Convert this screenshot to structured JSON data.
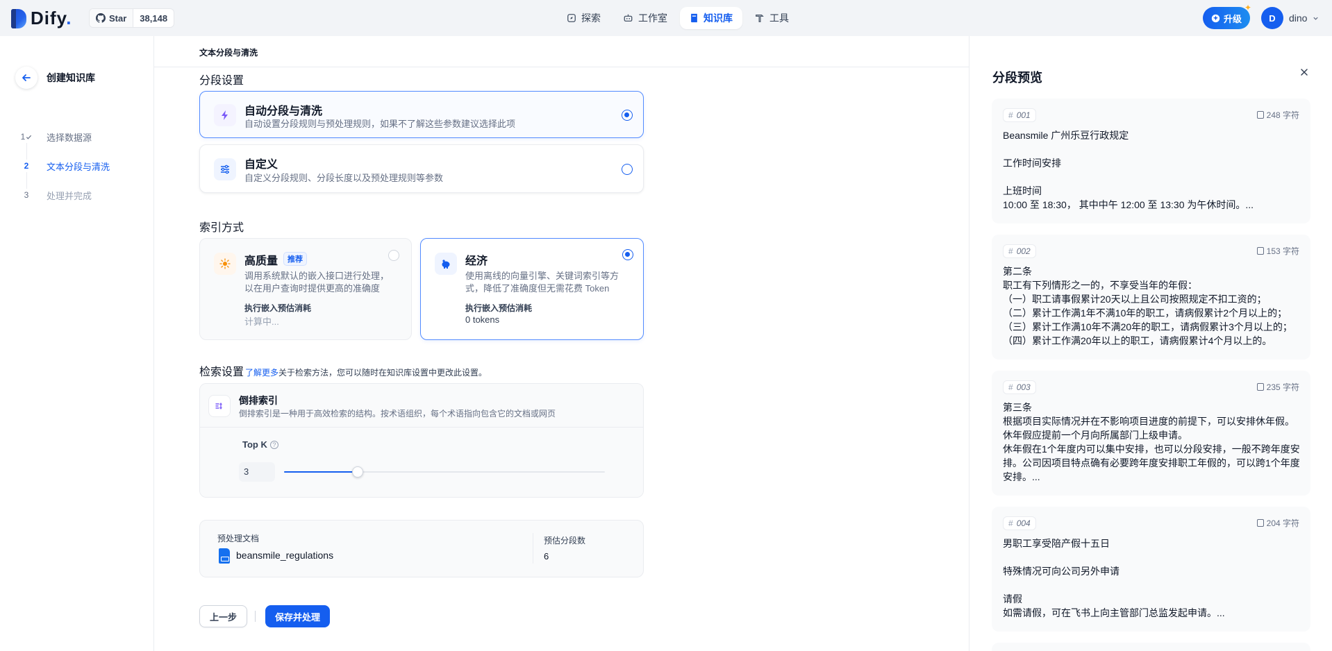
{
  "header": {
    "logo": {
      "text": "Dify",
      "dot": "."
    },
    "github": {
      "star_label": "Star",
      "count": "38,148"
    },
    "nav": [
      {
        "label": "探索",
        "icon": "explore-icon"
      },
      {
        "label": "工作室",
        "icon": "robot-icon"
      },
      {
        "label": "知识库",
        "icon": "book-icon",
        "active": true
      },
      {
        "label": "工具",
        "icon": "hammer-icon"
      }
    ],
    "upgrade_label": "升级",
    "user": {
      "initial": "D",
      "name": "dino"
    }
  },
  "sidebar": {
    "title": "创建知识库",
    "steps": [
      {
        "num": "1",
        "label": "选择数据源",
        "state": "done"
      },
      {
        "num": "2",
        "label": "文本分段与清洗",
        "state": "active"
      },
      {
        "num": "3",
        "label": "处理并完成",
        "state": "pending"
      }
    ]
  },
  "main": {
    "header_title": "文本分段与清洗",
    "segment_title": "分段设置",
    "segment_options": [
      {
        "title": "自动分段与清洗",
        "desc": "自动设置分段规则与预处理规则，如果不了解这些参数建议选择此项",
        "selected": true
      },
      {
        "title": "自定义",
        "desc": "自定义分段规则、分段长度以及预处理规则等参数",
        "selected": false
      }
    ],
    "index_title": "索引方式",
    "index_options": [
      {
        "title": "高质量",
        "badge": "推荐",
        "desc": "调用系统默认的嵌入接口进行处理，以在用户查询时提供更高的准确度",
        "cost_label": "执行嵌入预估消耗",
        "cost_value": "计算中...",
        "selected": false
      },
      {
        "title": "经济",
        "desc": "使用离线的向量引擎、关键词索引等方式，降低了准确度但无需花费 Token",
        "cost_label": "执行嵌入预估消耗",
        "cost_value": "0 tokens",
        "selected": true
      }
    ],
    "retrieval": {
      "title": "检索设置",
      "link": "了解更多",
      "note": "关于检索方法，您可以随时在知识库设置中更改此设置。",
      "method_title": "倒排索引",
      "method_desc": "倒排索引是一种用于高效检索的结构。按术语组织，每个术语指向包含它的文档或网页",
      "topk_label": "Top K",
      "topk_value": "3",
      "topk_fraction": 0.23
    },
    "summary": {
      "doc_label": "预处理文档",
      "doc_name": "beansmile_regulations",
      "count_label": "预估分段数",
      "count_value": "6"
    },
    "buttons": {
      "prev": "上一步",
      "save": "保存并处理"
    }
  },
  "preview": {
    "title": "分段预览",
    "chunks": [
      {
        "id": "001",
        "count": "248 字符",
        "text": "Beansmile 广州乐豆行政规定\n\n工作时间安排\n\n上班时间\n10:00 至 18:30， 其中中午 12:00 至 13:30 为午休时间。..."
      },
      {
        "id": "002",
        "count": "153 字符",
        "text": "第二条\n职工有下列情形之一的，不享受当年的年假：\n（一）职工请事假累计20天以上且公司按照规定不扣工资的；\n（二）累计工作满1年不满10年的职工，请病假累计2个月以上的；\n（三）累计工作满10年不满20年的职工，请病假累计3个月以上的；\n（四）累计工作满20年以上的职工，请病假累计4个月以上的。"
      },
      {
        "id": "003",
        "count": "235 字符",
        "text": "第三条\n根据项目实际情况并在不影响项目进度的前提下，可以安排休年假。休年假应提前一个月向所属部门上级申请。\n休年假在1个年度内可以集中安排，也可以分段安排，一般不跨年度安排。公司因项目特点确有必要跨年度安排职工年假的，可以跨1个年度安排。..."
      },
      {
        "id": "004",
        "count": "204 字符",
        "text": "男职工享受陪产假十五日\n\n特殊情况可向公司另外申请\n\n请假\n如需请假，可在飞书上向主管部门总监发起申请。..."
      }
    ]
  },
  "colors": {
    "accent": "#155eef",
    "border_selected": "#528bff"
  }
}
